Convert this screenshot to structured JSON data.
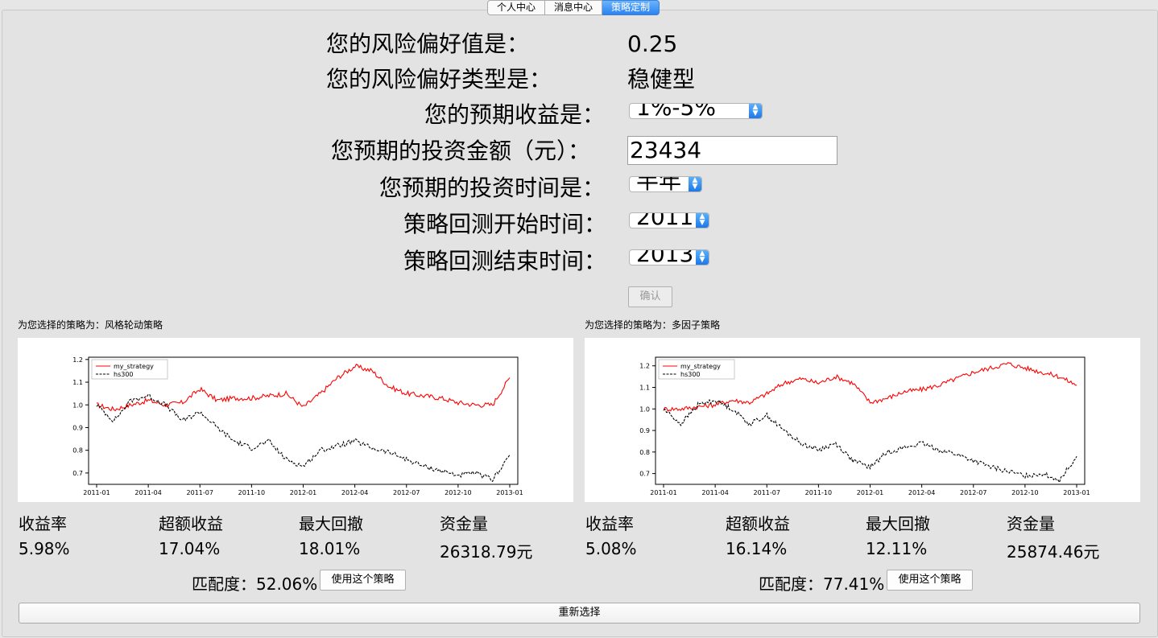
{
  "tabs": [
    "个人中心",
    "消息中心",
    "策略定制"
  ],
  "form": {
    "risk_value_label": "您的风险偏好值是：",
    "risk_value": "0.25",
    "risk_type_label": "您的风险偏好类型是：",
    "risk_type": "稳健型",
    "expected_return_label": "您的预期收益是：",
    "expected_return": "1%-5%",
    "amount_label": "您预期的投资金额（元）：",
    "amount": "23434",
    "duration_label": "您预期的投资时间是：",
    "duration": "半年",
    "start_label": "策略回测开始时间：",
    "start": "2011",
    "end_label": "策略回测结束时间：",
    "end": "2013",
    "confirm": "确认"
  },
  "strategies": [
    {
      "caption": "为您选择的策略为：风格轮动策略",
      "stats_headers": [
        "收益率",
        "超额收益",
        "最大回撤",
        "资金量"
      ],
      "stats_values": [
        "5.98%",
        "17.04%",
        "18.01%",
        "26318.79元"
      ],
      "match": "匹配度：52.06%",
      "use_button": "使用这个策略"
    },
    {
      "caption": "为您选择的策略为：多因子策略",
      "stats_headers": [
        "收益率",
        "超额收益",
        "最大回撤",
        "资金量"
      ],
      "stats_values": [
        "5.08%",
        "16.14%",
        "12.11%",
        "25874.46元"
      ],
      "match": "匹配度：77.41%",
      "use_button": "使用这个策略"
    }
  ],
  "reselect": "重新选择",
  "colors": {
    "strategy": "#ff0000",
    "benchmark": "#000000",
    "tab_active": "#2a83f2"
  },
  "chart_data": [
    {
      "type": "line",
      "title": "",
      "xlabel": "",
      "ylabel": "",
      "x": [
        "2011-01",
        "2011-02",
        "2011-03",
        "2011-04",
        "2011-05",
        "2011-06",
        "2011-07",
        "2011-08",
        "2011-09",
        "2011-10",
        "2011-11",
        "2011-12",
        "2012-01",
        "2012-02",
        "2012-03",
        "2012-04",
        "2012-05",
        "2012-06",
        "2012-07",
        "2012-08",
        "2012-09",
        "2012-10",
        "2012-11",
        "2012-12",
        "2013-01"
      ],
      "xticks": [
        "2011-01",
        "2011-04",
        "2011-07",
        "2011-10",
        "2012-01",
        "2012-04",
        "2012-07",
        "2012-10",
        "2013-01"
      ],
      "yticks": [
        "0.7",
        "0.8",
        "0.9",
        "1.0",
        "1.1",
        "1.2"
      ],
      "ylim": [
        0.65,
        1.21
      ],
      "legend_position": "top-left",
      "series": [
        {
          "name": "my_strategy",
          "style": "solid",
          "color": "red",
          "values": [
            1.0,
            0.98,
            1.0,
            1.02,
            1.0,
            1.01,
            1.07,
            1.02,
            1.03,
            1.03,
            1.04,
            1.05,
            0.99,
            1.05,
            1.12,
            1.17,
            1.15,
            1.08,
            1.05,
            1.04,
            1.03,
            1.01,
            1.0,
            1.0,
            1.12
          ]
        },
        {
          "name": "hs300",
          "style": "dashed",
          "color": "black",
          "values": [
            1.0,
            0.93,
            1.02,
            1.04,
            1.0,
            0.93,
            0.97,
            0.9,
            0.84,
            0.81,
            0.84,
            0.76,
            0.73,
            0.8,
            0.82,
            0.84,
            0.81,
            0.79,
            0.76,
            0.73,
            0.71,
            0.69,
            0.7,
            0.67,
            0.78
          ]
        }
      ]
    },
    {
      "type": "line",
      "title": "",
      "xlabel": "",
      "ylabel": "",
      "x": [
        "2011-01",
        "2011-02",
        "2011-03",
        "2011-04",
        "2011-05",
        "2011-06",
        "2011-07",
        "2011-08",
        "2011-09",
        "2011-10",
        "2011-11",
        "2011-12",
        "2012-01",
        "2012-02",
        "2012-03",
        "2012-04",
        "2012-05",
        "2012-06",
        "2012-07",
        "2012-08",
        "2012-09",
        "2012-10",
        "2012-11",
        "2012-12",
        "2013-01"
      ],
      "xticks": [
        "2011-01",
        "2011-04",
        "2011-07",
        "2011-10",
        "2012-01",
        "2012-04",
        "2012-07",
        "2012-10",
        "2013-01"
      ],
      "yticks": [
        "0.7",
        "0.8",
        "0.9",
        "1.0",
        "1.1",
        "1.2"
      ],
      "ylim": [
        0.65,
        1.24
      ],
      "legend_position": "top-left",
      "series": [
        {
          "name": "my_strategy",
          "style": "solid",
          "color": "red",
          "values": [
            1.0,
            1.0,
            1.01,
            1.02,
            1.04,
            1.03,
            1.07,
            1.12,
            1.14,
            1.12,
            1.15,
            1.12,
            1.03,
            1.05,
            1.08,
            1.09,
            1.11,
            1.14,
            1.17,
            1.19,
            1.21,
            1.19,
            1.17,
            1.15,
            1.11
          ]
        },
        {
          "name": "hs300",
          "style": "dashed",
          "color": "black",
          "values": [
            1.0,
            0.93,
            1.02,
            1.04,
            1.0,
            0.93,
            0.97,
            0.9,
            0.84,
            0.81,
            0.84,
            0.76,
            0.73,
            0.8,
            0.82,
            0.84,
            0.81,
            0.79,
            0.76,
            0.73,
            0.71,
            0.69,
            0.7,
            0.67,
            0.78
          ]
        }
      ]
    }
  ]
}
